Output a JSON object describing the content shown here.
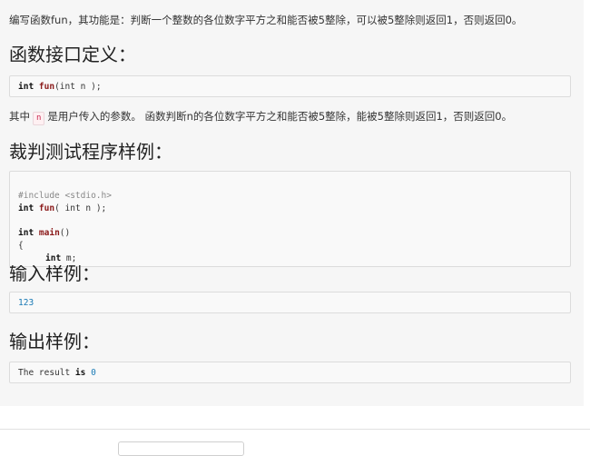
{
  "problem": {
    "description": "编写函数fun，其功能是：判断一个整数的各位数字平方之和能否被5整除，可以被5整除则返回1，否则返回0。",
    "interface_heading": "函数接口定义：",
    "interface_code": {
      "kw_int": "int",
      "fn_name": "fun",
      "params": "(int n );"
    },
    "param_note": {
      "prefix": "其中",
      "var": "n",
      "suffix": "是用户传入的参数。 函数判断n的各位数字平方之和能否被5整除，能被5整除则返回1，否则返回0。"
    },
    "sample_program_heading": "裁判测试程序样例：",
    "sample_program": {
      "line1": "#include <stdio.h>",
      "line2_kw": "int",
      "line2_fn": "fun",
      "line2_rest": "( int n );",
      "line3_kw": "int",
      "line3_fn": "main",
      "line3_rest": "()",
      "line4": "{",
      "line5_kw": "int",
      "line5_rest": " m;"
    },
    "input_heading": "输入样例：",
    "input_sample": "123",
    "output_heading": "输出样例：",
    "output_sample": {
      "text": "The result ",
      "kw": "is",
      "num": "0"
    }
  }
}
